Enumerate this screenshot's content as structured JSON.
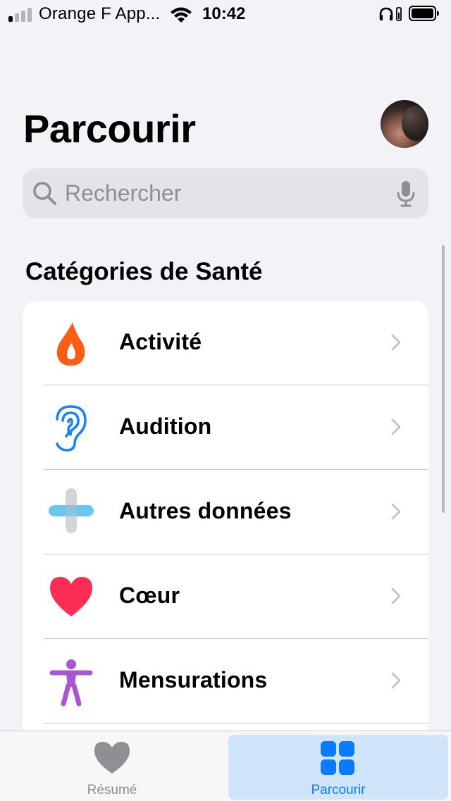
{
  "status_bar": {
    "carrier": "Orange F App...",
    "time": "10:42",
    "signal_bars_filled": 1,
    "signal_bars_total": 4,
    "wifi_icon": "wifi-icon",
    "headphones_icon": "headphones-icon",
    "battery_icon": "battery-icon"
  },
  "header": {
    "title": "Parcourir",
    "avatar_icon": "profile-avatar"
  },
  "search": {
    "placeholder": "Rechercher",
    "value": "",
    "search_icon": "magnifier-icon",
    "mic_icon": "microphone-icon"
  },
  "section": {
    "title": "Catégories de Santé"
  },
  "categories": [
    {
      "label": "Activité",
      "icon": "flame-icon",
      "color": "#fa5d13"
    },
    {
      "label": "Audition",
      "icon": "ear-icon",
      "color": "#1b84f2"
    },
    {
      "label": "Autres données",
      "icon": "plus-icon",
      "color": "#5ac2ee"
    },
    {
      "label": "Cœur",
      "icon": "heart-icon",
      "color": "#fe2d55"
    },
    {
      "label": "Mensurations",
      "icon": "body-icon",
      "color": "#a955d4"
    }
  ],
  "tab_bar": {
    "tabs": [
      {
        "label": "Résumé",
        "icon": "heart-icon",
        "selected": false
      },
      {
        "label": "Parcourir",
        "icon": "grid-icon",
        "selected": true
      }
    ]
  },
  "colors": {
    "accent": "#0a7aff",
    "background": "#f2f2f7",
    "card": "#ffffff",
    "chevron": "#c4c4c7",
    "secondary_text": "#8e8e93"
  }
}
